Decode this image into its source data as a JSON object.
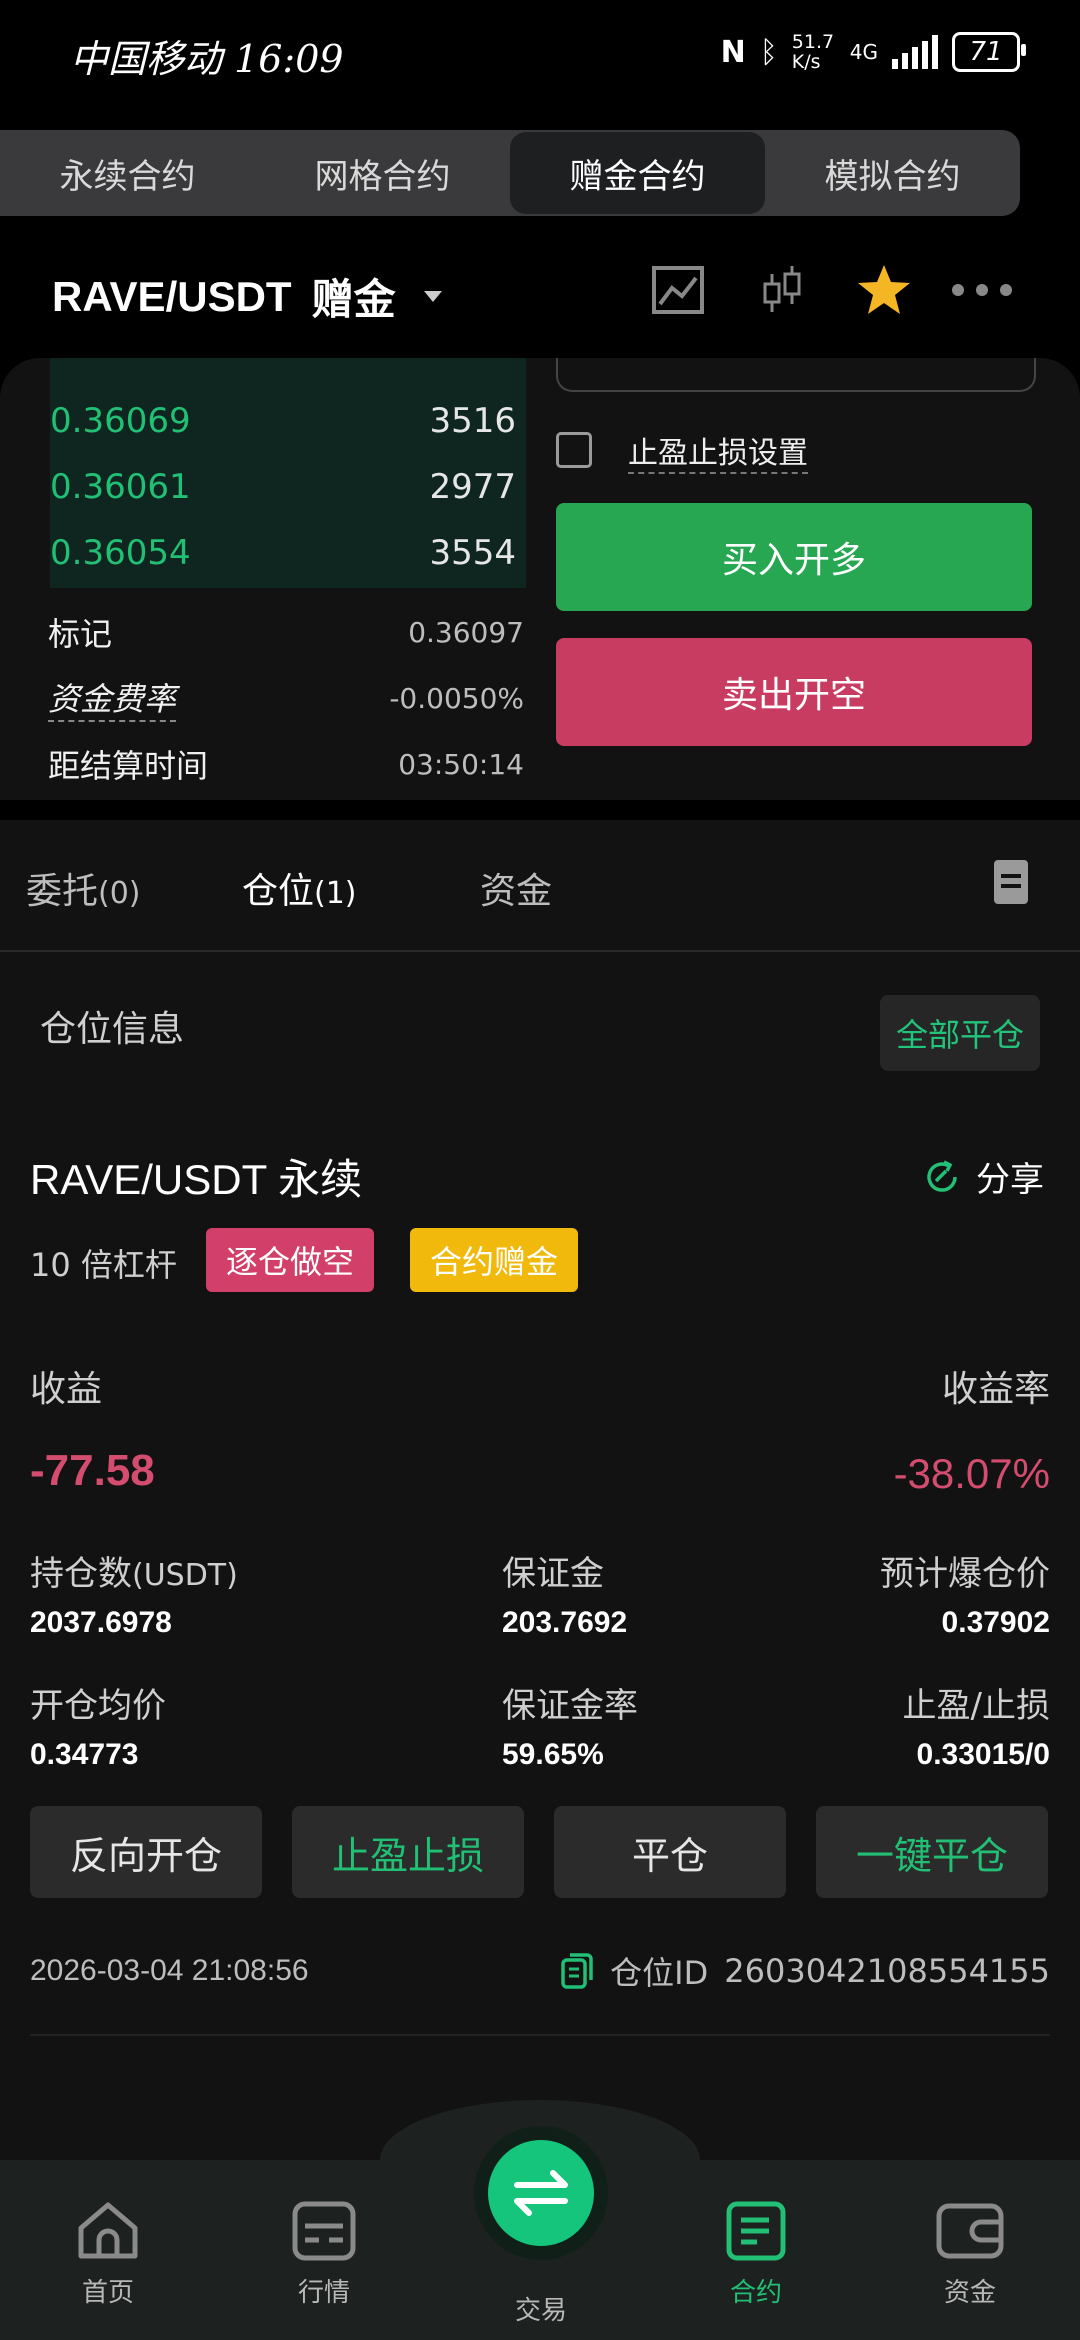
{
  "status_bar": {
    "carrier_time": "中国移动 16:09",
    "net_speed": "51.7 K/s",
    "net_type": "4G",
    "battery": "71"
  },
  "contract_tabs": [
    {
      "label": "永续合约",
      "active": false
    },
    {
      "label": "网格合约",
      "active": false
    },
    {
      "label": "赠金合约",
      "active": true
    },
    {
      "label": "模拟合约",
      "active": false
    }
  ],
  "header": {
    "pair": "RAVE/USDT",
    "mode": "赠金",
    "icons": [
      "chart-line-icon",
      "candlestick-icon",
      "star-icon",
      "more-icon"
    ],
    "star_color": "#f5b623"
  },
  "order_book": [
    {
      "price": "0.36069",
      "qty": "3516"
    },
    {
      "price": "0.36061",
      "qty": "2977"
    },
    {
      "price": "0.36054",
      "qty": "3554"
    }
  ],
  "market_info": {
    "mark_label": "标记",
    "mark_value": "0.36097",
    "funding_label": "资金费率",
    "funding_value": "-0.0050%",
    "settle_label": "距结算时间",
    "settle_value": "03:50:14"
  },
  "order_form": {
    "tp_sl_label": "止盈止损设置",
    "buy_label": "买入开多",
    "sell_label": "卖出开空"
  },
  "section_tabs": [
    {
      "label": "委托",
      "count": "(0)",
      "active": false
    },
    {
      "label": "仓位",
      "count": "(1)",
      "active": true
    },
    {
      "label": "资金",
      "count": "",
      "active": false
    }
  ],
  "position": {
    "section_title": "仓位信息",
    "close_all": "全部平仓",
    "symbol": "RAVE/USDT 永续",
    "share": "分享",
    "leverage": "10 倍杠杆",
    "tag_side": "逐仓做空",
    "tag_bonus": "合约赠金",
    "pnl_label": "收益",
    "pnl_rate_label": "收益率",
    "pnl": "-77.58",
    "pnl_rate": "-38.07%",
    "size_label": "持仓数",
    "size_unit": "(USDT)",
    "size": "2037.6978",
    "margin_label": "保证金",
    "margin": "203.7692",
    "liq_label": "预计爆仓价",
    "liq": "0.37902",
    "entry_label": "开仓均价",
    "entry": "0.34773",
    "margin_rate_label": "保证金率",
    "margin_rate": "59.65%",
    "tpsl_label": "止盈/止损",
    "tpsl": "0.33015/0",
    "actions": [
      "反向开仓",
      "止盈止损",
      "平仓",
      "一键平仓"
    ],
    "time": "2026-03-04 21:08:56",
    "id_label": "仓位ID",
    "id": "2603042108554155"
  },
  "colors": {
    "green": "#21c074",
    "red": "#d54d6e",
    "buy": "#28a753",
    "sell": "#c93c62",
    "bonus_tag": "#f0b90b"
  },
  "bottom_nav": [
    {
      "label": "首页",
      "icon": "home-icon",
      "active": false
    },
    {
      "label": "行情",
      "icon": "market-icon",
      "active": false
    },
    {
      "label": "交易",
      "icon": "swap-icon",
      "active": false
    },
    {
      "label": "合约",
      "icon": "contract-icon",
      "active": true
    },
    {
      "label": "资金",
      "icon": "wallet-icon",
      "active": false
    }
  ]
}
